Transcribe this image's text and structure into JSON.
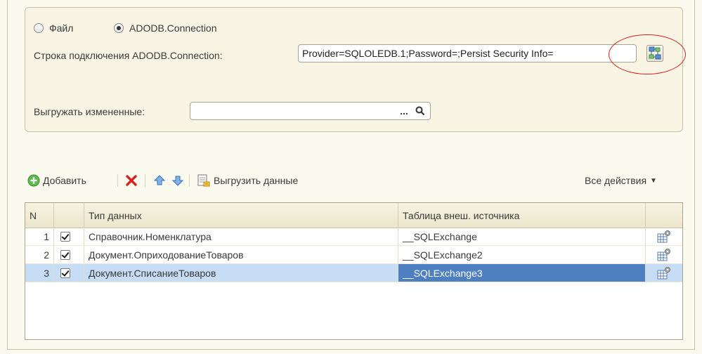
{
  "source": {
    "options": [
      {
        "label": "Файл",
        "selected": false
      },
      {
        "label": "ADODB.Connection",
        "selected": true
      }
    ],
    "connection_label": "Строка подключения  ADODB.Connection:",
    "connection_value": "Provider=SQLOLEDB.1;Password=;Persist Security Info=",
    "changed_label": "Выгружать измененные:",
    "changed_value": "",
    "select_button": "...",
    "search_icon": "search-icon"
  },
  "toolbar": {
    "add_label": "Добавить",
    "export_label": "Выгрузить данные",
    "all_actions_label": "Все действия",
    "icons": [
      "add-icon",
      "delete-icon",
      "move-up-icon",
      "move-down-icon",
      "export-data-icon",
      "chevron-down-icon"
    ]
  },
  "table": {
    "headers": [
      "N",
      "",
      "Тип данных",
      "Таблица внеш. источника",
      ""
    ],
    "rows": [
      {
        "n": "1",
        "checked": true,
        "type": "Справочник.Номенклатура",
        "source": "__SQLExchange",
        "selected": false
      },
      {
        "n": "2",
        "checked": true,
        "type": "Документ.ОприходованиеТоваров",
        "source": "__SQLExchange2",
        "selected": false
      },
      {
        "n": "3",
        "checked": true,
        "type": "Документ.СписаниеТоваров",
        "source": "__SQLExchange3",
        "selected": true
      }
    ]
  },
  "colors": {
    "background": "#fbfaee",
    "selection": "#c7dcf5",
    "selected_cell": "#4e7fc1",
    "highlight_ellipse": "#d9201c"
  }
}
